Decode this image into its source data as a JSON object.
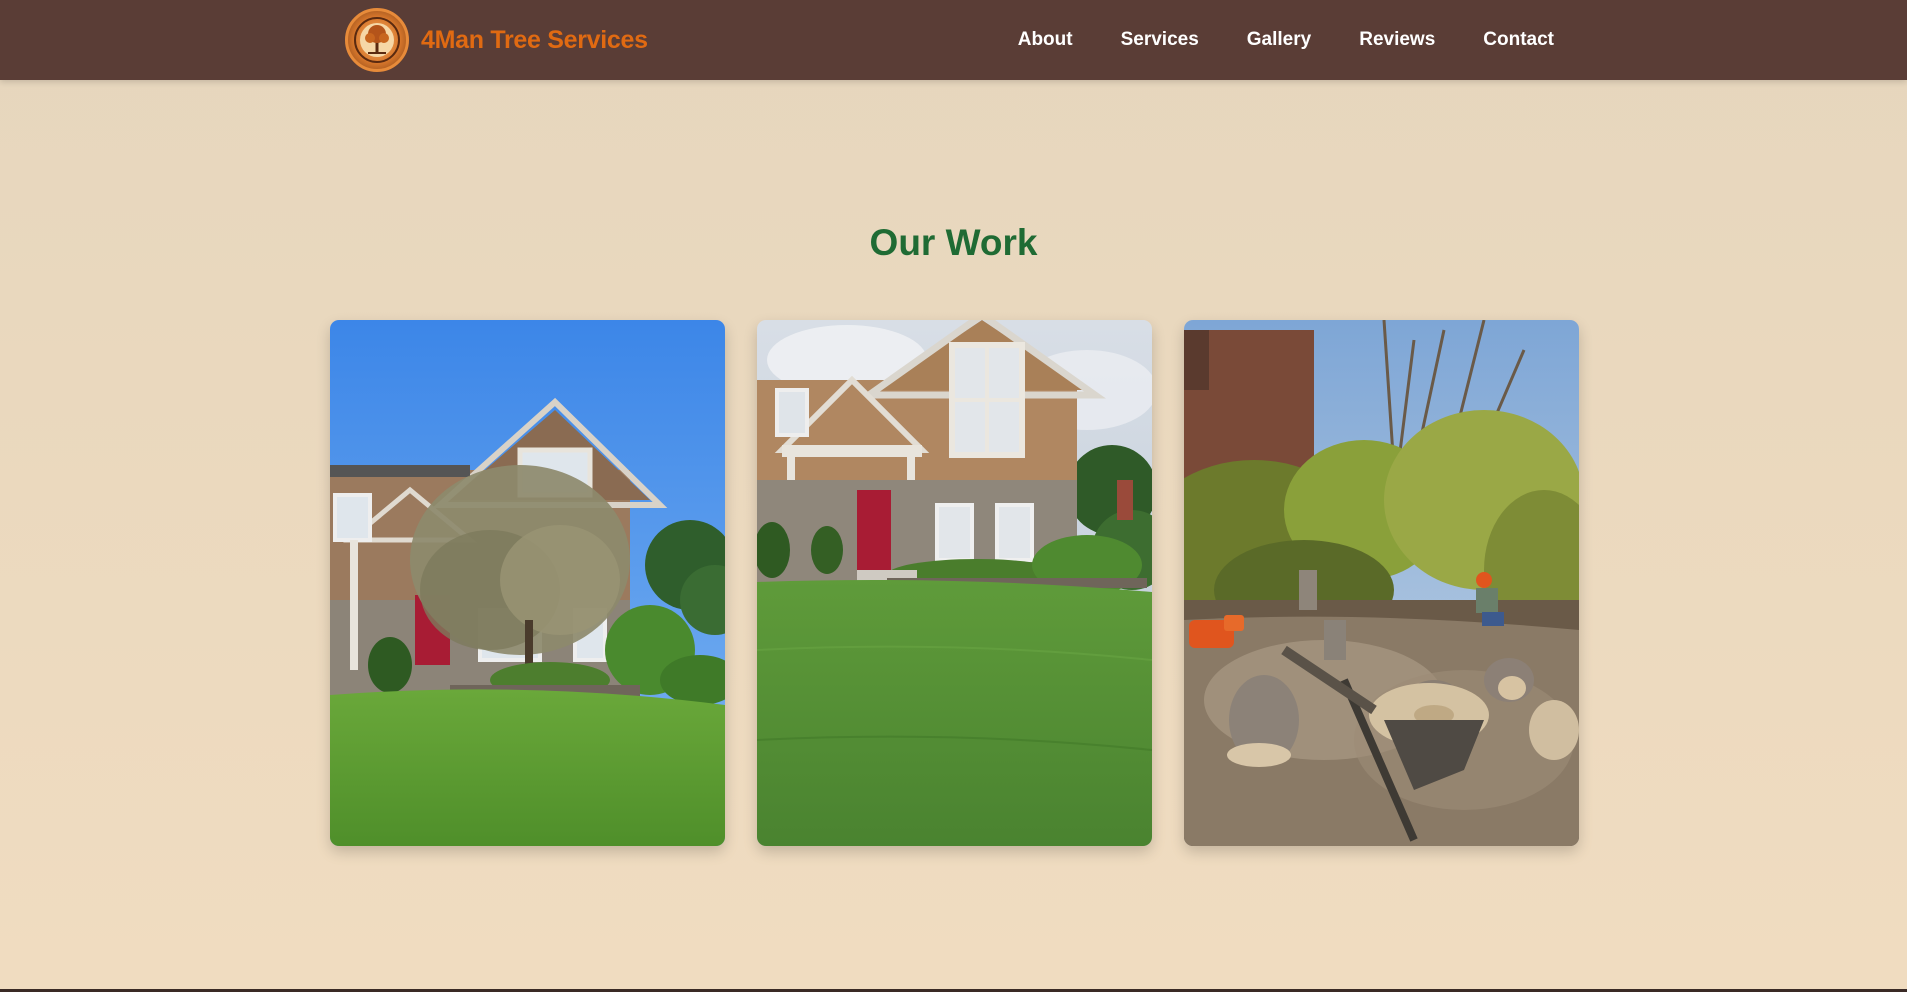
{
  "header": {
    "brand_name": "4Man Tree Services",
    "logo_icon": "tree-emblem-icon",
    "nav": [
      {
        "label": "About"
      },
      {
        "label": "Services"
      },
      {
        "label": "Gallery"
      },
      {
        "label": "Reviews"
      },
      {
        "label": "Contact"
      }
    ]
  },
  "gallery": {
    "title": "Our Work",
    "photos": [
      {
        "subject": "house-with-tree-before"
      },
      {
        "subject": "house-lawn-after"
      },
      {
        "subject": "felled-tree-stumps"
      }
    ]
  },
  "colors": {
    "header_bg": "#5a3d36",
    "brand": "#e06a12",
    "title": "#1f6b34",
    "page_bg": "#e6d6bd"
  }
}
